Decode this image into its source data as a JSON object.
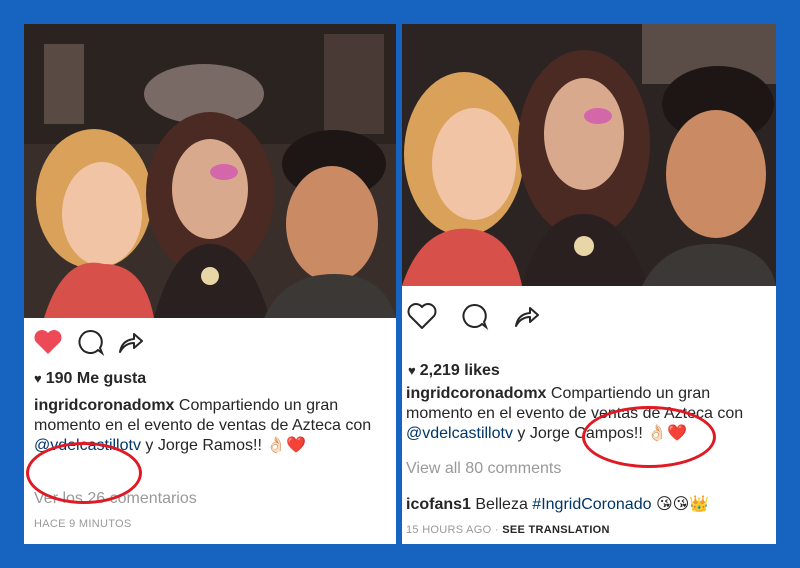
{
  "left_post": {
    "likes_count": "190 Me gusta",
    "username": "ingridcoronadomx",
    "caption_text": " Compartiendo un gran momento en el evento de ventas de Azteca con ",
    "mention": "@vdelcastillotv",
    "caption_y": " y Jorge ",
    "highlight_name": "Ramos!!",
    "emojis": " 👌🏻❤️",
    "view_comments": "Ver los 26 comentarios",
    "time": "HACE 9 MINUTOS"
  },
  "right_post": {
    "likes_count": "2,219 likes",
    "username": "ingridcoronadomx",
    "caption_text": " Compartiendo un gran momento en el evento de ventas de Azteca con ",
    "mention": "@vdelcastillotv",
    "caption_y": " y Jorge ",
    "highlight_name": "Campos!!",
    "emojis": " 👌🏻❤️",
    "view_comments": "View all 80 comments",
    "comment_user": "icofans1",
    "comment_text": " Belleza ",
    "comment_tag": "#IngridCoronado",
    "comment_emojis": " 😘😘👑",
    "time": "15 HOURS AGO",
    "time_sep": " · ",
    "see_translation": "SEE TRANSLATION"
  },
  "colors": {
    "background": "#1664c0",
    "like_active": "#ed4956",
    "highlight_circle": "#e01a24",
    "mention": "#003569",
    "muted": "#999999"
  },
  "icons": [
    "heart-icon",
    "comment-icon",
    "share-icon"
  ]
}
